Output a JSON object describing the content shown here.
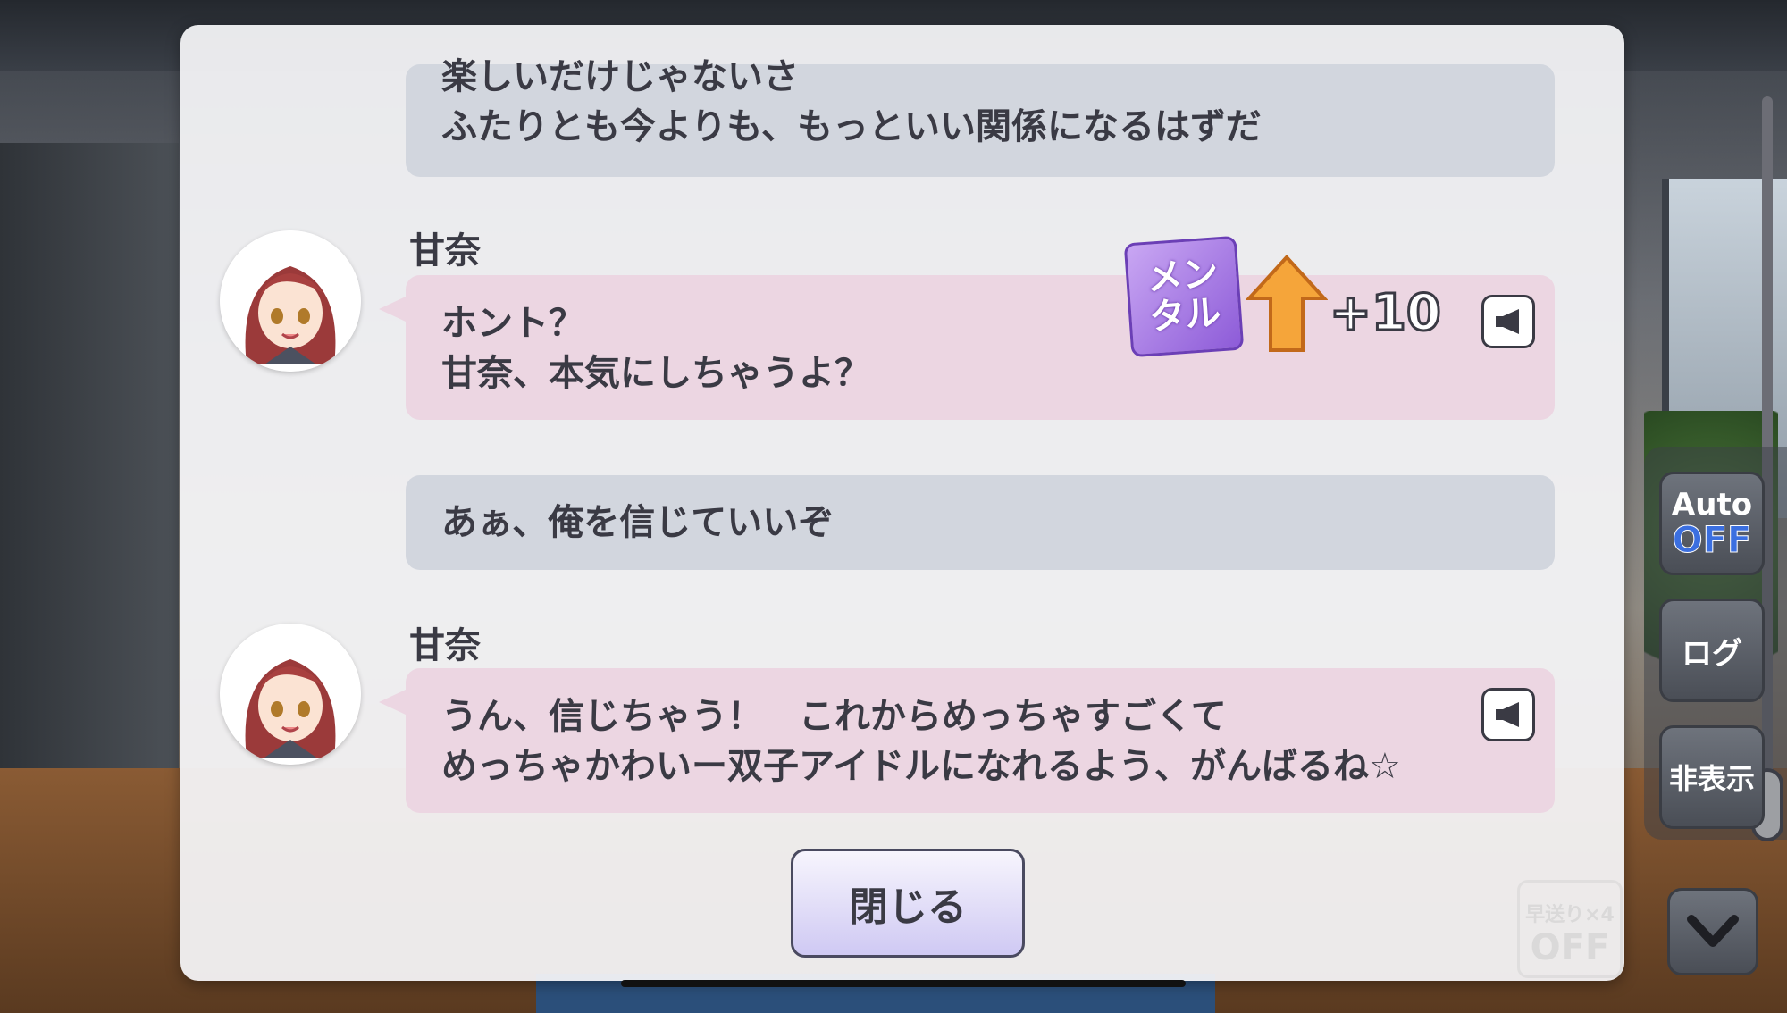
{
  "dialogue": [
    {
      "speaker": "",
      "lines": [
        "楽しいだけじゃないさ",
        "ふたりとも今よりも、もっといい関係になるはずだ"
      ]
    },
    {
      "speaker": "甘奈",
      "lines": [
        "ホント？",
        "甘奈、本気にしちゃうよ？"
      ]
    },
    {
      "speaker": "",
      "lines": [
        "あぁ、俺を信じていいぞ"
      ]
    },
    {
      "speaker": "甘奈",
      "lines": [
        "うん、信じちゃう！　これからめっちゃすごくて",
        "めっちゃかわいー双子アイドルになれるよう、がんばるね☆"
      ]
    }
  ],
  "stat_gain": {
    "label_line1": "メン",
    "label_line2": "タル",
    "value": "+10",
    "badge_color": "#a978e6"
  },
  "close_button": {
    "label": "閉じる"
  },
  "side_controls": {
    "auto_label": "Auto",
    "auto_state": "OFF",
    "log_label": "ログ",
    "hide_label": "非表示",
    "fast_forward_label": "早送り×4",
    "fast_forward_state": "OFF"
  },
  "icons": {
    "voice": "speaker-icon",
    "arrow_up": "arrow-up-icon",
    "chevron": "chevron-down-icon"
  }
}
